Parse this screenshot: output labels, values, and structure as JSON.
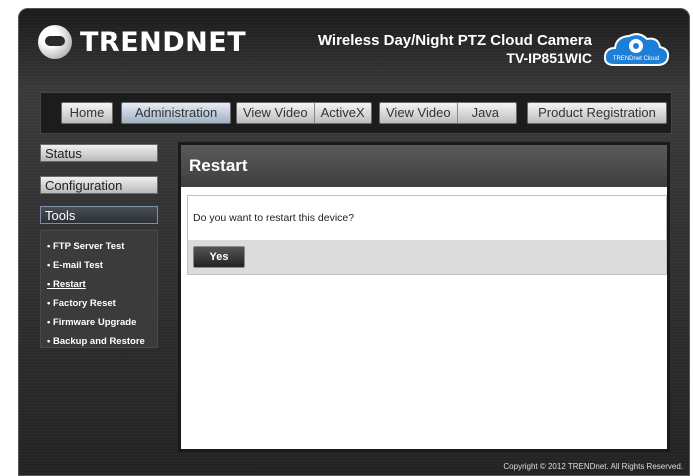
{
  "header": {
    "brand": "TRENDNET",
    "title": "Wireless Day/Night PTZ Cloud Camera",
    "model": "TV-IP851WIC",
    "cloud_label": "TRENDnet Cloud"
  },
  "nav": {
    "home": "Home",
    "administration": "Administration",
    "view_video_activex": "View Video",
    "activex": "ActiveX",
    "view_video_java": "View Video",
    "java": "Java",
    "product_registration": "Product Registration"
  },
  "sidebar": {
    "status": "Status",
    "configuration": "Configuration",
    "tools": "Tools",
    "items": [
      "• FTP Server Test",
      "• E-mail Test",
      "• Restart",
      "• Factory Reset",
      "• Firmware Upgrade",
      "• Backup and Restore"
    ]
  },
  "content": {
    "title": "Restart",
    "question": "Do you want to restart this device?",
    "yes_label": "Yes"
  },
  "footer": {
    "copyright": "Copyright © 2012 TRENDnet.  All Rights Reserved."
  },
  "colors": {
    "frame_bg": "#2f2f2f",
    "active_nav": "#9fb0c4",
    "cloud_blue": "#1e7fd8"
  }
}
